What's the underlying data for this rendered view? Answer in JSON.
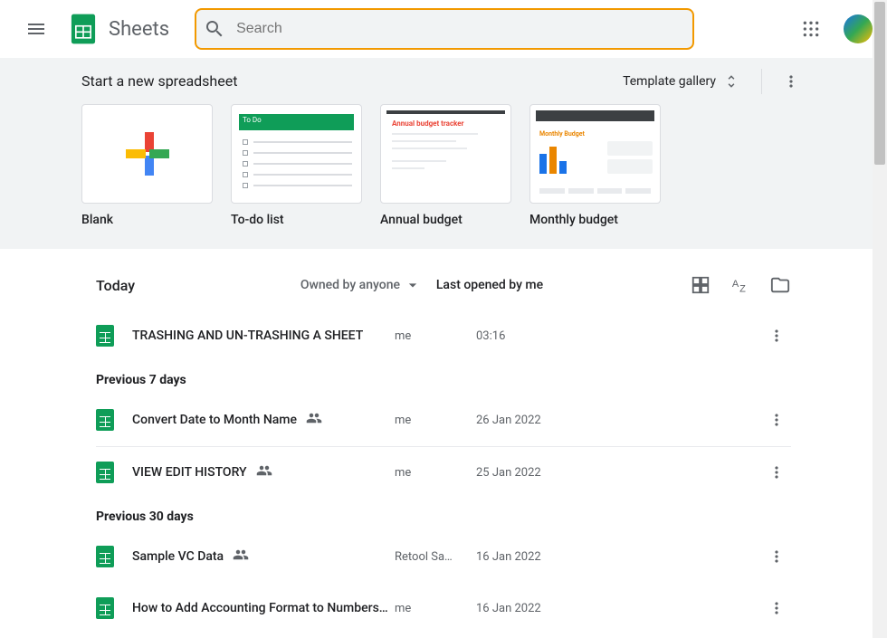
{
  "app": {
    "name": "Sheets"
  },
  "search": {
    "placeholder": "Search"
  },
  "templates": {
    "title": "Start a new spreadsheet",
    "gallery_label": "Template gallery",
    "cards": [
      {
        "label": "Blank"
      },
      {
        "label": "To-do list",
        "thumb_title": "To Do"
      },
      {
        "label": "Annual budget",
        "thumb_title": "Annual budget tracker"
      },
      {
        "label": "Monthly budget",
        "thumb_title": "Monthly Budget"
      }
    ]
  },
  "doclist": {
    "header": {
      "section": "Today",
      "owner_filter": "Owned by anyone",
      "sort": "Last opened by me"
    },
    "sections": [
      {
        "title": "Today",
        "rows": [
          {
            "name": "TRASHING AND UN-TRASHING A SHEET",
            "owner": "me",
            "date": "03:16",
            "shared": false
          }
        ]
      },
      {
        "title": "Previous 7 days",
        "rows": [
          {
            "name": "Convert Date to Month Name",
            "owner": "me",
            "date": "26 Jan 2022",
            "shared": true
          },
          {
            "name": "VIEW EDIT HISTORY",
            "owner": "me",
            "date": "25 Jan 2022",
            "shared": true
          }
        ]
      },
      {
        "title": "Previous 30 days",
        "rows": [
          {
            "name": "Sample VC Data",
            "owner": "Retool Sa…",
            "date": "16 Jan 2022",
            "shared": true
          },
          {
            "name": "How to Add Accounting Format to Numbers…",
            "owner": "me",
            "date": "16 Jan 2022",
            "shared": false
          }
        ]
      }
    ]
  }
}
